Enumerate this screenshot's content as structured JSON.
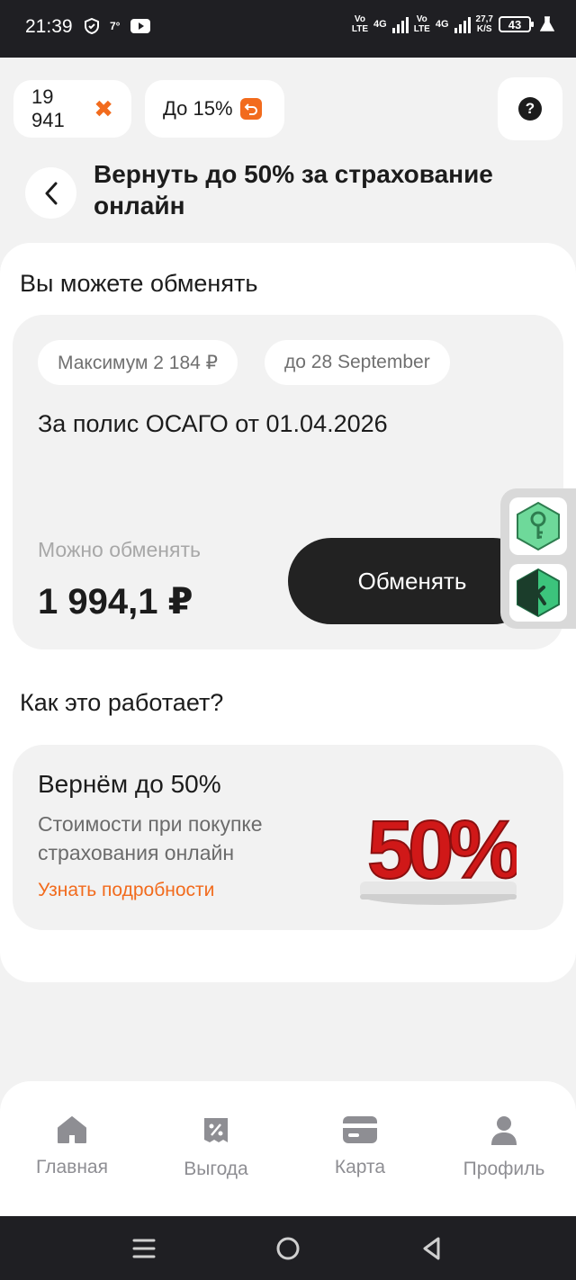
{
  "status_bar": {
    "time": "21:39",
    "temp": "7°",
    "network_speed_top": "27,7",
    "network_speed_bottom": "K/S",
    "vo_lte_1": "Vo",
    "lte_1": "LTE",
    "net_1": "4G",
    "vo_lte_2": "Vo",
    "lte_2": "LTE",
    "net_2": "4G",
    "battery": "43"
  },
  "top_chips": {
    "coins": "19 941",
    "percent": "До 15%"
  },
  "header": {
    "title": "Вернуть до 50% за страхование онлайн"
  },
  "exchange": {
    "section_title": "Вы можете обменять",
    "max_pill": "Максимум 2 184 ₽",
    "date_pill": "до 28 September",
    "policy": "За полис ОСАГО от 01.04.2026",
    "can_exchange_label": "Можно обменять",
    "amount": "1 994,1 ₽",
    "button": "Обменять"
  },
  "how_it_works": {
    "section_title": "Как это работает?",
    "card_title": "Вернём до 50%",
    "card_subtitle": "Стоимости при покупке страхования онлайн",
    "link": "Узнать подробности",
    "promo_text": "50%"
  },
  "bottom_nav": {
    "items": [
      {
        "label": "Главная",
        "icon": "home-icon"
      },
      {
        "label": "Выгода",
        "icon": "discount-icon"
      },
      {
        "label": "Карта",
        "icon": "card-icon"
      },
      {
        "label": "Профиль",
        "icon": "profile-icon"
      }
    ]
  },
  "colors": {
    "accent": "#f26b1d",
    "dark": "#222222",
    "background": "#f2f2f2"
  }
}
